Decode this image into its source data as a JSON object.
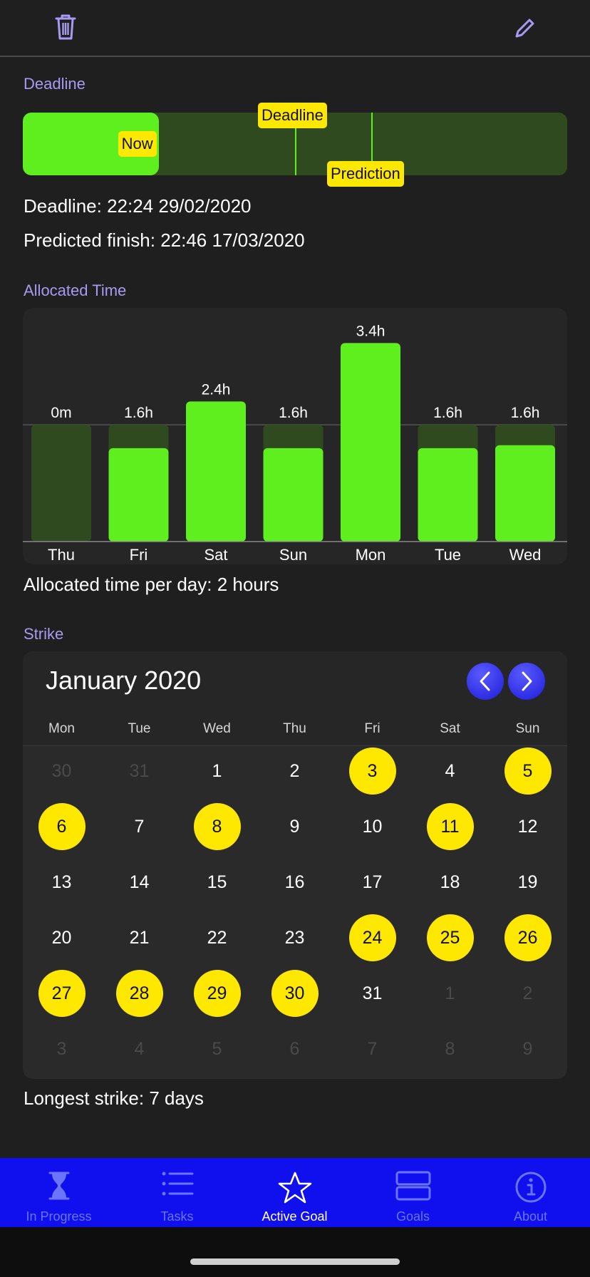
{
  "colors": {
    "accent": "#a79af2",
    "green": "#60ef1e",
    "green_dark": "#2f4a1f",
    "yellow": "#ffe800",
    "tab_bg": "#1010ee",
    "tab_inactive": "#6b74ff"
  },
  "toolbar": {
    "delete_icon": "trash-icon",
    "edit_icon": "pencil-icon"
  },
  "deadline": {
    "title": "Deadline",
    "now_label": "Now",
    "deadline_label": "Deadline",
    "prediction_label": "Prediction",
    "now_fraction": 0.25,
    "deadline_fraction": 0.5,
    "prediction_fraction": 0.64,
    "deadline_text": "Deadline: 22:24 29/02/2020",
    "predicted_text": "Predicted finish: 22:46 17/03/2020"
  },
  "allocated": {
    "title": "Allocated Time",
    "summary": "Allocated time per day: 2 hours"
  },
  "chart_data": {
    "type": "bar",
    "categories": [
      "Thu",
      "Fri",
      "Sat",
      "Sun",
      "Mon",
      "Tue",
      "Wed"
    ],
    "values": [
      0,
      1.6,
      2.4,
      1.6,
      3.4,
      1.6,
      1.65
    ],
    "labels": [
      "0m",
      "1.6h",
      "2.4h",
      "1.6h",
      "3.4h",
      "1.6h",
      "1.6h"
    ],
    "target": 2,
    "ylim": [
      0,
      3.6
    ],
    "title": "",
    "xlabel": "",
    "ylabel": ""
  },
  "strike": {
    "title": "Strike",
    "month_label": "January 2020",
    "prev_icon": "chevron-left-icon",
    "next_icon": "chevron-right-icon",
    "weekdays": [
      "Mon",
      "Tue",
      "Wed",
      "Thu",
      "Fri",
      "Sat",
      "Sun"
    ],
    "weeks": [
      [
        {
          "d": "30",
          "m": true
        },
        {
          "d": "31",
          "m": true
        },
        {
          "d": "1"
        },
        {
          "d": "2"
        },
        {
          "d": "3",
          "h": true
        },
        {
          "d": "4"
        },
        {
          "d": "5",
          "h": true
        }
      ],
      [
        {
          "d": "6",
          "h": true
        },
        {
          "d": "7"
        },
        {
          "d": "8",
          "h": true
        },
        {
          "d": "9"
        },
        {
          "d": "10"
        },
        {
          "d": "11",
          "h": true
        },
        {
          "d": "12"
        }
      ],
      [
        {
          "d": "13"
        },
        {
          "d": "14"
        },
        {
          "d": "15"
        },
        {
          "d": "16"
        },
        {
          "d": "17"
        },
        {
          "d": "18"
        },
        {
          "d": "19"
        }
      ],
      [
        {
          "d": "20"
        },
        {
          "d": "21"
        },
        {
          "d": "22"
        },
        {
          "d": "23"
        },
        {
          "d": "24",
          "h": true
        },
        {
          "d": "25",
          "h": true
        },
        {
          "d": "26",
          "h": true
        }
      ],
      [
        {
          "d": "27",
          "h": true
        },
        {
          "d": "28",
          "h": true
        },
        {
          "d": "29",
          "h": true
        },
        {
          "d": "30",
          "h": true
        },
        {
          "d": "31"
        },
        {
          "d": "1",
          "m": true
        },
        {
          "d": "2",
          "m": true
        }
      ],
      [
        {
          "d": "3",
          "m": true
        },
        {
          "d": "4",
          "m": true
        },
        {
          "d": "5",
          "m": true
        },
        {
          "d": "6",
          "m": true
        },
        {
          "d": "7",
          "m": true
        },
        {
          "d": "8",
          "m": true
        },
        {
          "d": "9",
          "m": true
        }
      ]
    ],
    "longest_text": "Longest strike: 7 days"
  },
  "tabs": [
    {
      "label": "In Progress",
      "icon": "hourglass-icon",
      "active": false
    },
    {
      "label": "Tasks",
      "icon": "list-icon",
      "active": false
    },
    {
      "label": "Active Goal",
      "icon": "star-icon",
      "active": true
    },
    {
      "label": "Goals",
      "icon": "stack-icon",
      "active": false
    },
    {
      "label": "About",
      "icon": "info-icon",
      "active": false
    }
  ]
}
